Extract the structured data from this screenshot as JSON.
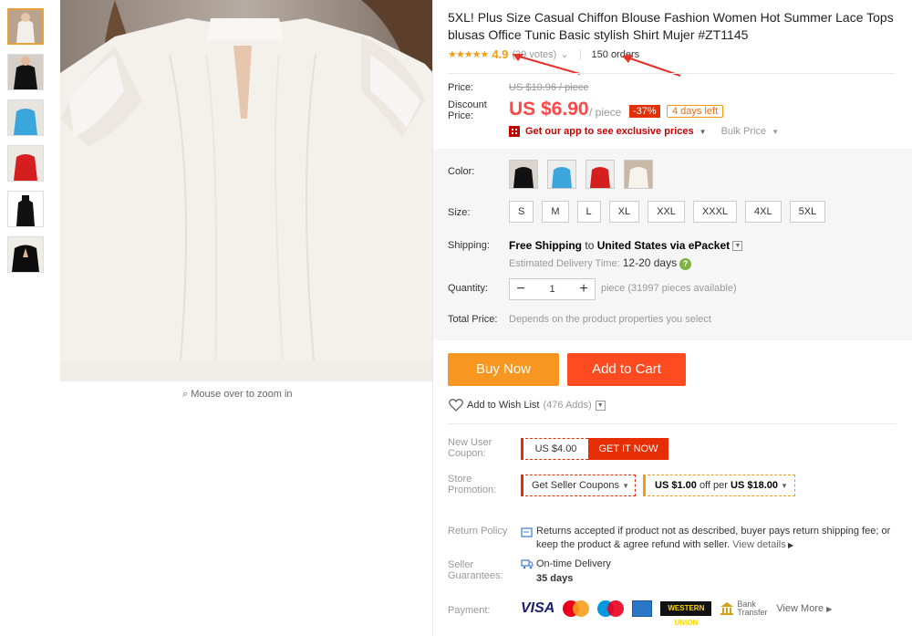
{
  "thumbnails": [
    "white",
    "black",
    "blue",
    "red",
    "black-collar",
    "black-keyhole"
  ],
  "product": {
    "title": "5XL! Plus Size Casual Chiffon Blouse Fashion Women Hot Summer Lace Tops blusas Office Tunic Basic stylish Shirt Mujer #ZT1145",
    "stars": "★★★★★",
    "rating": "4.9",
    "votes": "(39 votes)",
    "orders": "150 orders",
    "zoom_hint": "Mouse over to zoom in"
  },
  "price": {
    "label": "Price:",
    "original": "US $10.96 / piece",
    "discount_label": "Discount Price:",
    "current": "US $6.90",
    "unit": "/ piece",
    "discount_badge": "-37%",
    "days_left": "4 days left",
    "app_promo": "Get our app to see exclusive prices",
    "bulk": "Bulk Price"
  },
  "options": {
    "color_label": "Color:",
    "colors": [
      "black",
      "blue",
      "red",
      "white"
    ],
    "size_label": "Size:",
    "sizes": [
      "S",
      "M",
      "L",
      "XL",
      "XXL",
      "XXXL",
      "4XL",
      "5XL"
    ]
  },
  "shipping": {
    "label": "Shipping:",
    "text_prefix": "Free Shipping",
    "to": "to",
    "destination": "United States via ePacket",
    "est_label": "Estimated Delivery Time:",
    "est_days": "12-20 days"
  },
  "quantity": {
    "label": "Quantity:",
    "value": "1",
    "minus": "−",
    "plus": "+",
    "info": "piece (31997 pieces available)"
  },
  "total": {
    "label": "Total Price:",
    "info": "Depends on the product properties you select"
  },
  "actions": {
    "buy_now": "Buy Now",
    "add_to_cart": "Add to Cart",
    "wishlist": "Add to Wish List",
    "wishlist_count": "(476 Adds)"
  },
  "coupons": {
    "new_user_label": "New User Coupon:",
    "new_user_value": "US $4.00",
    "get_it_now": "GET IT NOW",
    "store_label": "Store Promotion:",
    "seller_coupons": "Get Seller Coupons",
    "promo_amount": "US $1.00",
    "promo_mid": "off per",
    "promo_min": "US $18.00"
  },
  "policy": {
    "return_label": "Return Policy",
    "return_text": "Returns accepted if product not as described, buyer pays return shipping fee; or keep the product & agree refund with seller.",
    "view_details": "View details",
    "guarantee_label": "Seller Guarantees:",
    "guarantee_1": "On-time Delivery",
    "guarantee_2": "35 days"
  },
  "payment": {
    "label": "Payment:",
    "visa": "VISA",
    "wu": "WESTERN UNION",
    "bank": "Bank Transfer",
    "view_more": "View More"
  },
  "colors": {
    "accent": "#ff4747",
    "buy": "#f79722",
    "cart": "#ff4b1f",
    "star": "#f39c12"
  }
}
